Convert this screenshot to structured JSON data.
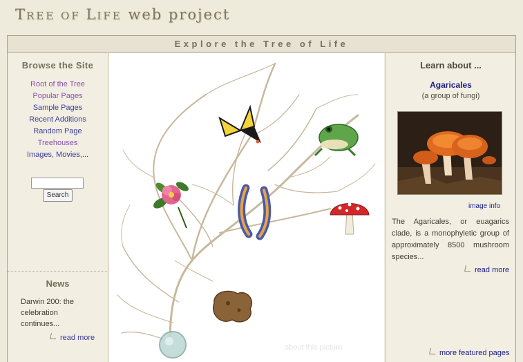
{
  "site": {
    "title_part1": "T",
    "title_part2": "REE OF ",
    "title_part3": "L",
    "title_part4": "IFE",
    "title_part5": " web project"
  },
  "explore_bar": {
    "label": "Explore the Tree of Life"
  },
  "browse": {
    "title": "Browse the Site",
    "items": [
      {
        "label": "Root of the Tree",
        "color": "#8a4fb3"
      },
      {
        "label": "Popular Pages",
        "color": "#8a4fb3"
      },
      {
        "label": "Sample Pages",
        "color": "#3b3b9a"
      },
      {
        "label": "Recent Additions",
        "color": "#3b3b9a"
      },
      {
        "label": "Random Page",
        "color": "#3b3b9a"
      },
      {
        "label": "Treehouses",
        "color": "#8a4fb3"
      },
      {
        "label": "Images, Movies,...",
        "color": "#3b3b9a"
      }
    ],
    "search": {
      "value": "",
      "button_label": "Search"
    }
  },
  "news": {
    "title": "News",
    "text": "Darwin 200: the celebration continues...",
    "more_label": "read more"
  },
  "center": {
    "about_picture_label": "about this picture",
    "organisms": [
      "butterfly",
      "frog",
      "rose",
      "worm",
      "mushroom",
      "sea-creature",
      "cell"
    ]
  },
  "learn": {
    "title": "Learn about ...",
    "featured_name": "Agaricales",
    "featured_sub": "(a group of fungi)",
    "image_info_label": "image info",
    "description": "The Agaricales, or euagarics clade, is a monophyletic group of approximately 8500 mushroom species...",
    "more_label": "read more",
    "more_featured_label": "more featured pages"
  },
  "colors": {
    "background": "#efebdc",
    "title": "#7c7660",
    "link_blue": "#3b3b9a",
    "link_purple": "#8a4fb3",
    "tree_branch": "#c8b89c"
  }
}
